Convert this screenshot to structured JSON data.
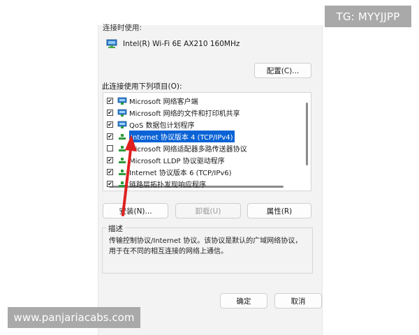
{
  "watermarks": {
    "top_right": "TG: MYYJJPP",
    "bottom_left": "www.panjariacabs.com"
  },
  "dialog": {
    "connect_using_label": "连接时使用:",
    "adapter_name": "Intel(R) Wi-Fi 6E AX210 160MHz",
    "configure_button": "配置(C)...",
    "items_label": "此连接使用下列项目(O):",
    "items": [
      {
        "label": "Microsoft 网络客户端",
        "checked": true,
        "icon": "network-client-icon"
      },
      {
        "label": "Microsoft 网络的文件和打印机共享",
        "checked": true,
        "icon": "file-printer-sharing-icon"
      },
      {
        "label": "QoS 数据包计划程序",
        "checked": true,
        "icon": "qos-scheduler-icon"
      },
      {
        "label": "Internet 协议版本 4 (TCP/IPv4)",
        "checked": true,
        "icon": "protocol-icon",
        "selected": true
      },
      {
        "label": "Microsoft 网络适配器多路传送器协议",
        "checked": false,
        "icon": "protocol-icon"
      },
      {
        "label": "Microsoft LLDP 协议驱动程序",
        "checked": true,
        "icon": "protocol-icon"
      },
      {
        "label": "Internet 协议版本 6 (TCP/IPv6)",
        "checked": true,
        "icon": "protocol-icon"
      },
      {
        "label": "链路层拓扑发现响应程序",
        "checked": true,
        "icon": "protocol-icon"
      }
    ],
    "install_button": "安装(N)...",
    "uninstall_button": "卸载(U)",
    "properties_button": "属性(R)",
    "description_title": "描述",
    "description_text": "传输控制协议/Internet 协议。该协议是默认的广域网络协议，用于在不同的相互连接的网络上通信。",
    "ok_button": "确定",
    "cancel_button": "取消"
  },
  "colors": {
    "selection": "#0b63d6",
    "annotation_arrow": "#e02020"
  }
}
